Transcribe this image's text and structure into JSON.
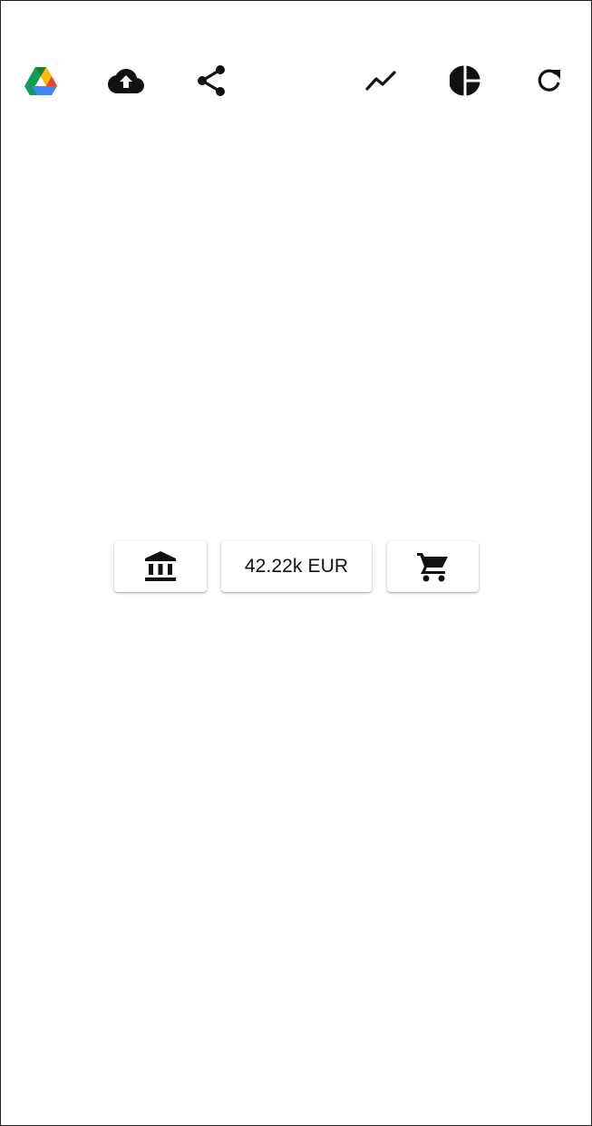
{
  "toolbar": {
    "items": [
      {
        "name": "google-drive-icon"
      },
      {
        "name": "cloud-upload-icon"
      },
      {
        "name": "share-icon"
      },
      {
        "name": "line-chart-icon"
      },
      {
        "name": "pie-chart-icon"
      },
      {
        "name": "refresh-icon"
      }
    ]
  },
  "actions": {
    "bank_icon": "bank-icon",
    "balance_label": "42.22k EUR",
    "cart_icon": "shopping-cart-icon"
  },
  "colors": {
    "background": "#ffffff",
    "icon": "#111111",
    "drive_green": "#0F9D58",
    "drive_yellow": "#FBBC04",
    "drive_blue": "#4285F4",
    "drive_red": "#EA4335"
  }
}
